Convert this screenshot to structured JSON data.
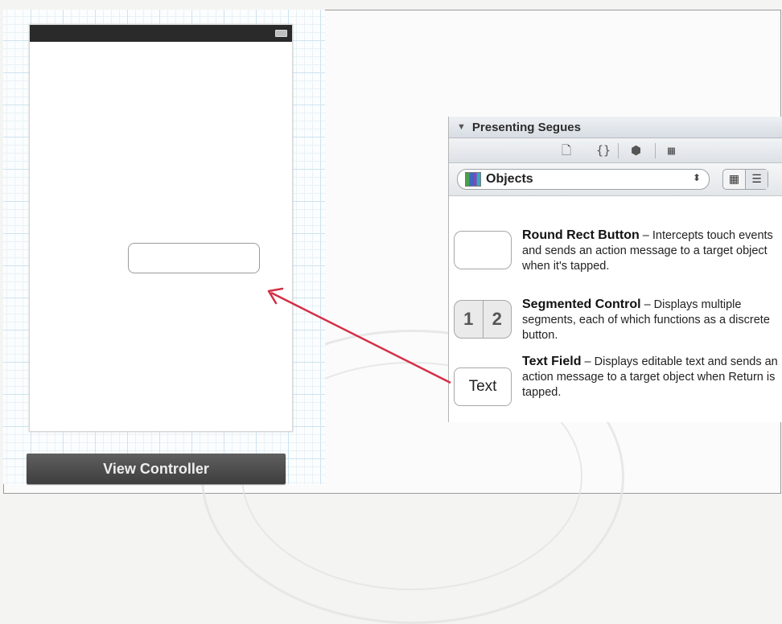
{
  "storyboard": {
    "view_controller_label": "View Controller"
  },
  "library": {
    "header": "Presenting Segues",
    "toolbar_icons": [
      "file-icon",
      "braces-icon",
      "cube-icon",
      "media-icon"
    ],
    "selector_value": "Objects",
    "items": [
      {
        "title": "Round Rect Button",
        "description": " – Intercepts touch events and sends an action message to a target object when it's tapped.",
        "thumbnail": ""
      },
      {
        "title": "Segmented Control",
        "description": " – Displays multiple segments, each of which functions as a discrete button.",
        "thumbnail_segments": [
          "1",
          "2"
        ]
      },
      {
        "title": "Text Field",
        "description": " – Displays editable text and sends an action message to a target object when Return is tapped.",
        "thumbnail": "Text"
      }
    ]
  },
  "colors": {
    "arrow": "#d32f45",
    "status_bar": "#2a2a2a",
    "view_controller_bar": "#4a4a4a"
  }
}
